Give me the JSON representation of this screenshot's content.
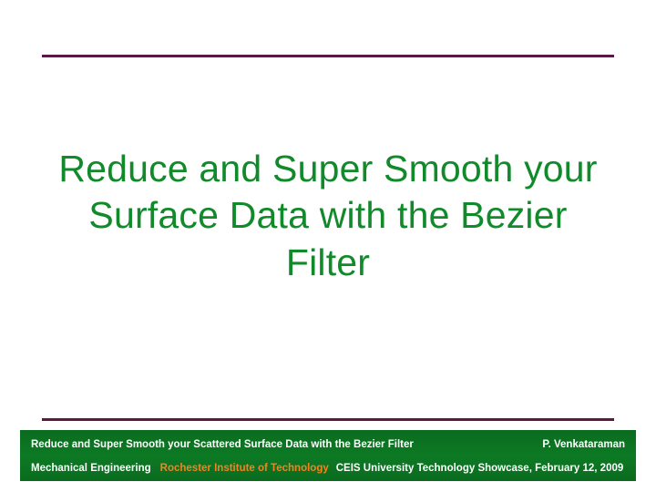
{
  "title": "Reduce and Super Smooth your Surface Data with the Bezier Filter",
  "footer": {
    "line1_left": "Reduce and Super Smooth your Scattered Surface Data with the Bezier Filter",
    "line1_right": "P. Venkataraman",
    "dept": "Mechanical Engineering",
    "institution": "Rochester Institute of Technology",
    "event": "CEIS University Technology Showcase,  February 12, 2009"
  }
}
